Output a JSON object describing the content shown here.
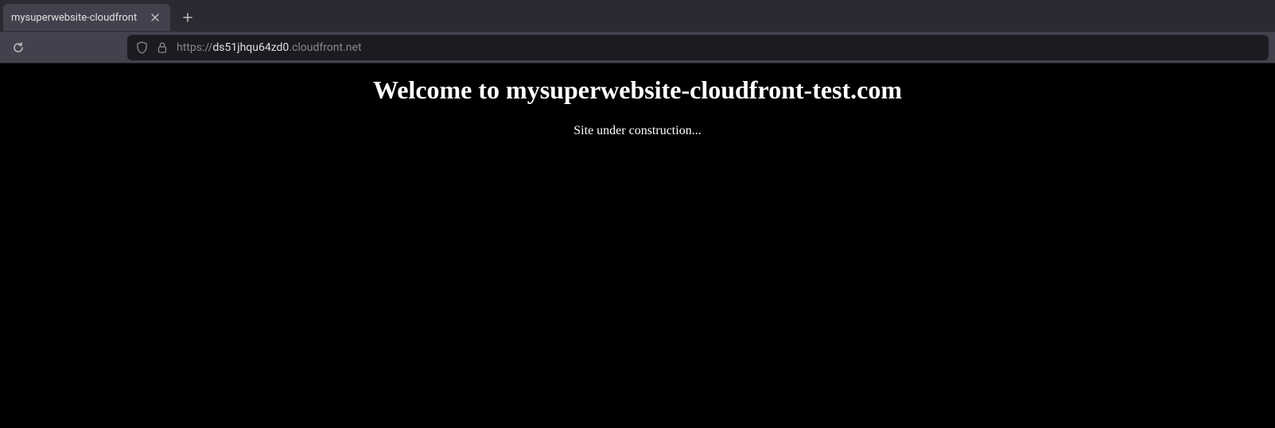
{
  "tab": {
    "title": "mysuperwebsite-cloudfront"
  },
  "address": {
    "protocol": "https://",
    "host": "ds51jhqu64zd0",
    "tld": ".cloudfront.net"
  },
  "page": {
    "heading": "Welcome to mysuperwebsite-cloudfront-test.com",
    "subtext": "Site under construction..."
  }
}
